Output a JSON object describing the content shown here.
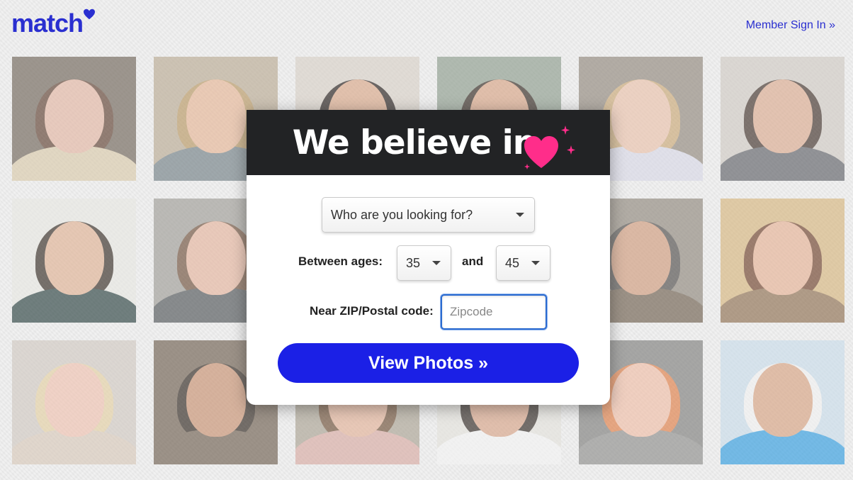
{
  "header": {
    "logo_text": "match",
    "signin_label": "Member Sign In »",
    "brand_color": "#2a2fd0"
  },
  "modal": {
    "title": "We believe in",
    "heart_color": "#ff2d8a",
    "looking_for": {
      "value": "Who are you looking for?"
    },
    "ages": {
      "label": "Between ages:",
      "min": "35",
      "and_label": "and",
      "max": "45"
    },
    "zip": {
      "label": "Near ZIP/Postal code:",
      "placeholder": "Zipcode",
      "value": ""
    },
    "cta_label": "View Photos »",
    "cta_color": "#1b20e6"
  },
  "photos": [
    {
      "bg": "#6b6054",
      "skin": "#e3b4a0",
      "hair": "#5a3a2a",
      "shirt": "#d9c9a8"
    },
    {
      "bg": "#b8a890",
      "skin": "#e6b493",
      "hair": "#b7955e",
      "shirt": "#6e7c82"
    },
    {
      "bg": "#d8d0c6",
      "skin": "#d9a585",
      "hair": "#1c1412",
      "shirt": "#2a2420"
    },
    {
      "bg": "#8a9a8a",
      "skin": "#d8a282",
      "hair": "#2b2018",
      "shirt": "#6b6f72"
    },
    {
      "bg": "#8e8478",
      "skin": "#eac0a8",
      "hair": "#c9a672",
      "shirt": "#d8d8e6"
    },
    {
      "bg": "#cfc9c2",
      "skin": "#dba88c",
      "hair": "#3a2a22",
      "shirt": "#5a5c62"
    },
    {
      "bg": "#e8e8e2",
      "skin": "#e0b091",
      "hair": "#2e241c",
      "shirt": "#233b3a"
    },
    {
      "bg": "#9c9a94",
      "skin": "#e5b39b",
      "hair": "#6a4a34",
      "shirt": "#4a4f52"
    },
    {
      "bg": "#c8bfb0",
      "skin": "#d8a488",
      "hair": "#2b2520",
      "shirt": "#7a6a5a"
    },
    {
      "bg": "#dcd8d0",
      "skin": "#d5a084",
      "hair": "#3a2a20",
      "shirt": "#f2f2f2"
    },
    {
      "bg": "#8c8478",
      "skin": "#cf9878",
      "hair": "#4a4744",
      "shirt": "#6a5a48"
    },
    {
      "bg": "#d6b47a",
      "skin": "#e6b092",
      "hair": "#6a3a22",
      "shirt": "#8a6a4a"
    },
    {
      "bg": "#d0c8c0",
      "skin": "#f0c0ae",
      "hair": "#e4cfa0",
      "shirt": "#d8c8b8"
    },
    {
      "bg": "#6a5a4a",
      "skin": "#c78e6c",
      "hair": "#2a2018",
      "shirt": "#6a5a4a"
    },
    {
      "bg": "#a8a090",
      "skin": "#e3b095",
      "hair": "#6a4a30",
      "shirt": "#d8a8a0"
    },
    {
      "bg": "#e4e2dc",
      "skin": "#d8a285",
      "hair": "#2a221c",
      "shirt": "#f4f4f4"
    },
    {
      "bg": "#7a7a78",
      "skin": "#f0bca4",
      "hair": "#e07a40",
      "shirt": "#8a8a88"
    },
    {
      "bg": "#c8dcea",
      "skin": "#d7a07e",
      "hair": "#f2f2f2",
      "shirt": "#2a9ae0"
    }
  ]
}
